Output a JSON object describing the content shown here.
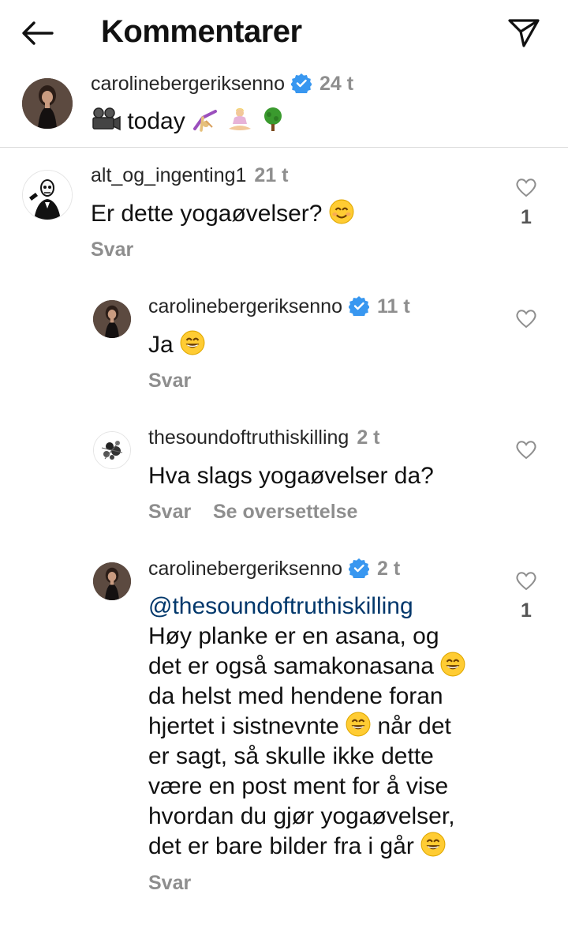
{
  "header": {
    "title": "Kommentarer",
    "back_icon": "arrow-left-icon",
    "share_icon": "paper-plane-icon"
  },
  "caption": {
    "username": "carolinebergeriksenno",
    "verified": true,
    "time": "24 t",
    "text": "today",
    "emojis": [
      "film-projector-emoji",
      "cartwheel-emoji",
      "lotus-position-emoji",
      "tree-emoji"
    ]
  },
  "comments": [
    {
      "username": "alt_og_ingenting1",
      "verified": false,
      "time": "21 t",
      "text": "Er dette yogaøvelser?",
      "emoji": "smiling-face-emoji",
      "reply_label": "Svar",
      "like_count": "1"
    },
    {
      "username": "carolinebergeriksenno",
      "verified": true,
      "time": "11 t",
      "text": "Ja",
      "emoji": "grinning-face-emoji",
      "reply_label": "Svar",
      "like_count": ""
    },
    {
      "username": "thesoundoftruthiskilling",
      "verified": false,
      "time": "2 t",
      "text": "Hva slags yogaøvelser da?",
      "reply_label": "Svar",
      "translate_label": "Se oversettelse",
      "like_count": ""
    },
    {
      "username": "carolinebergeriksenno",
      "verified": true,
      "time": "2 t",
      "mention": "@thesoundoftruthiskilling",
      "lines": [
        "Høy planke er en asana, og",
        "det er også samakonasana",
        "da helst med hendene foran",
        "hjertet i sistnevnte",
        "når det",
        "er sagt, så skulle ikke dette",
        "være en post ment for å vise",
        "hvordan du gjør yogaøvelser,",
        "det er bare bilder fra i går"
      ],
      "reply_label": "Svar",
      "like_count": "1"
    }
  ],
  "colors": {
    "verified": "#3897f0",
    "secondary_text": "#8e8e8e",
    "mention": "#00376b",
    "divider": "#dbdbdb"
  }
}
